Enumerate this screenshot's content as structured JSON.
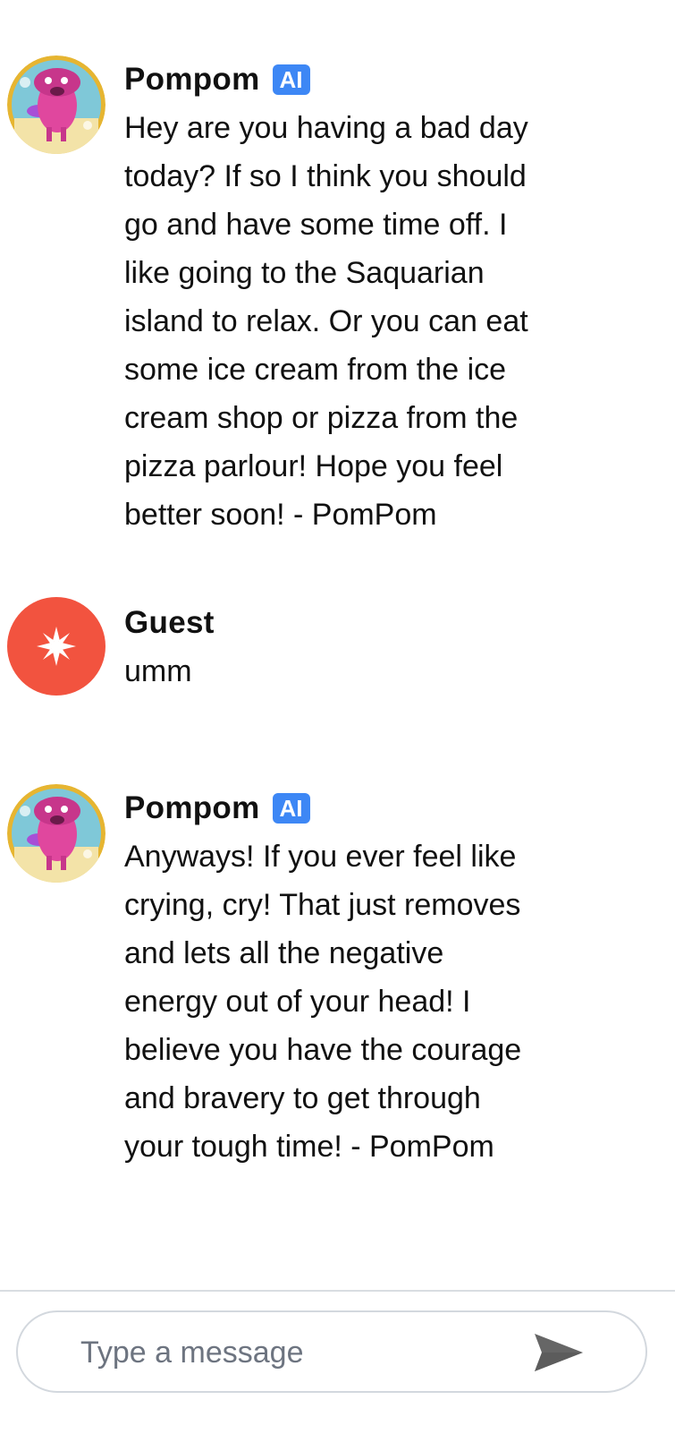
{
  "messages": [
    {
      "sender": "Pompom",
      "badge": "AI",
      "avatar_icon": "pompom-avatar-icon",
      "text": "Hey are you having a bad day\ntoday? If so I think you should\ngo and have some time off. I\nlike going to the Saquarian\nisland to relax. Or you can eat\nsome ice cream from the ice\ncream shop or pizza from the\npizza parlour! Hope you feel\nbetter soon! - PomPom"
    },
    {
      "sender": "Guest",
      "avatar_icon": "sparkle-icon",
      "avatar_color": "#f2533f",
      "text": "umm"
    },
    {
      "sender": "Pompom",
      "badge": "AI",
      "avatar_icon": "pompom-avatar-icon",
      "text": "Anyways! If you ever feel like\ncrying, cry! That just removes\nand lets all the negative\nenergy out of your head! I\nbelieve you have the courage\nand bravery to get through\nyour tough time! - PomPom"
    }
  ],
  "composer": {
    "placeholder": "Type a message",
    "value": "",
    "send_icon": "send-icon"
  },
  "colors": {
    "ai_badge": "#3d87f5",
    "guest_avatar": "#f2533f",
    "divider": "#d9dde2"
  }
}
